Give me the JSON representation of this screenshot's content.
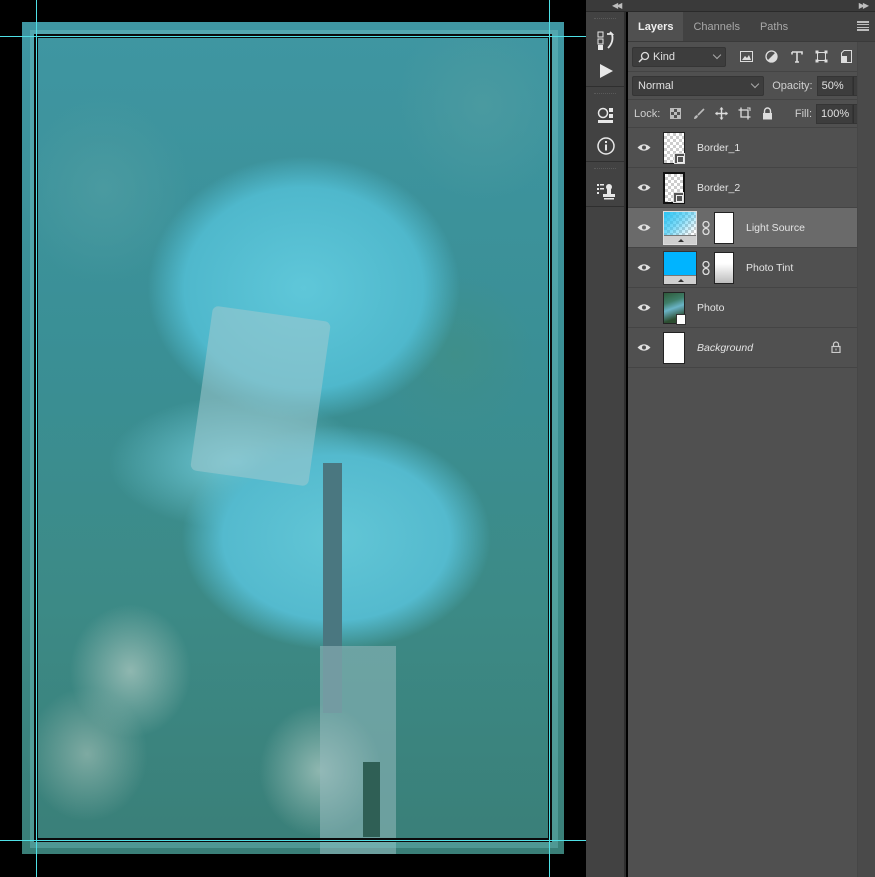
{
  "canvas": {
    "document_description": "Aerial photo of a tropical garden pool with cyan tint overlay",
    "guides": {
      "vertical_count": 2,
      "horizontal_count": 2
    }
  },
  "toolbar_icons": [
    {
      "name": "history-icon",
      "label": "History"
    },
    {
      "name": "actions-play-icon",
      "label": "Actions"
    },
    {
      "name": "libraries-icon",
      "label": "3D / Properties"
    },
    {
      "name": "info-icon",
      "label": "Info"
    },
    {
      "name": "clone-source-icon",
      "label": "Clone Source"
    }
  ],
  "panel": {
    "tabs": [
      {
        "label": "Layers",
        "active": true
      },
      {
        "label": "Channels",
        "active": false
      },
      {
        "label": "Paths",
        "active": false
      }
    ],
    "filter": {
      "kind_label": "Kind",
      "icons": [
        "pixel-filter-icon",
        "adjustment-filter-icon",
        "type-filter-icon",
        "shape-filter-icon",
        "smart-object-filter-icon"
      ]
    },
    "blend_mode": "Normal",
    "opacity_label": "Opacity:",
    "opacity_value": "50%",
    "lock_label": "Lock:",
    "fill_label": "Fill:",
    "fill_value": "100%",
    "layers": [
      {
        "name": "Border_1",
        "type": "shape",
        "visible": true,
        "selected": false,
        "locked": false,
        "italic": false
      },
      {
        "name": "Border_2",
        "type": "shape",
        "visible": true,
        "selected": false,
        "locked": false,
        "italic": false
      },
      {
        "name": "Light Source",
        "type": "gradient-fill",
        "visible": true,
        "selected": true,
        "locked": false,
        "italic": false,
        "color": "#29c4f5"
      },
      {
        "name": "Photo Tint",
        "type": "solid-fill",
        "visible": true,
        "selected": false,
        "locked": false,
        "italic": false,
        "color": "#00b4ff"
      },
      {
        "name": "Photo",
        "type": "smart-object",
        "visible": true,
        "selected": false,
        "locked": false,
        "italic": false
      },
      {
        "name": "Background",
        "type": "background",
        "visible": true,
        "selected": false,
        "locked": true,
        "italic": true
      }
    ]
  },
  "colors": {
    "guide": "#4fe0e6",
    "panel_bg": "#505050",
    "selected_row": "#6a6a6a",
    "tint_fill": "#00b4ff"
  }
}
